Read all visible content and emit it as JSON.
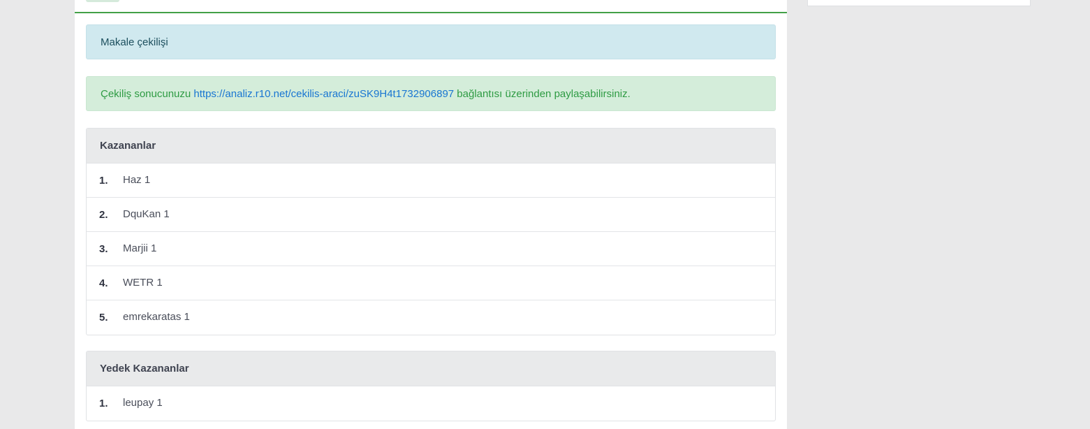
{
  "info_alert": {
    "text": "Makale çekilişi"
  },
  "success_alert": {
    "prefix": "Çekiliş sonucunuzu ",
    "link": "https://analiz.r10.net/cekilis-araci/zuSK9H4t1732906897",
    "suffix": " bağlantısı üzerinden paylaşabilirsiniz."
  },
  "winners": {
    "title": "Kazananlar",
    "items": [
      {
        "rank": "1.",
        "name": "Haz 1"
      },
      {
        "rank": "2.",
        "name": "DquKan 1"
      },
      {
        "rank": "3.",
        "name": "Marjii 1"
      },
      {
        "rank": "4.",
        "name": "WETR 1"
      },
      {
        "rank": "5.",
        "name": "emrekaratas 1"
      }
    ]
  },
  "backup_winners": {
    "title": "Yedek Kazananlar",
    "items": [
      {
        "rank": "1.",
        "name": "leupay 1"
      }
    ]
  }
}
